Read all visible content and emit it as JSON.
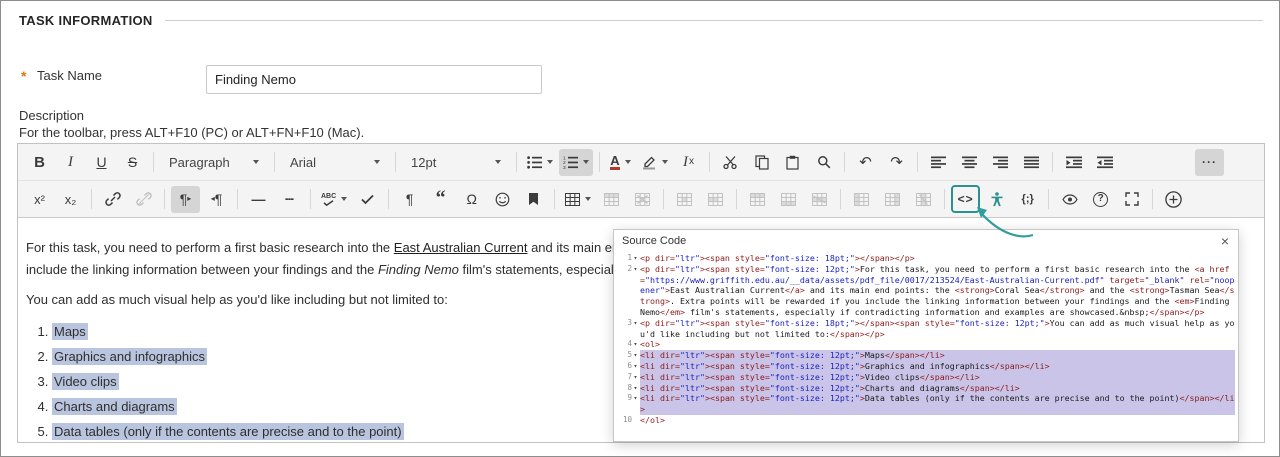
{
  "page": {
    "section_title": "TASK INFORMATION",
    "required_marker": "*",
    "task_name_label": "Task Name",
    "task_name_value": "Finding Nemo",
    "description_label": "Description",
    "toolbar_hint": "For the toolbar, press ALT+F10 (PC) or ALT+FN+F10 (Mac)."
  },
  "colors": {
    "accent_teal": "#2e8f8f",
    "selection_blue": "#b9c5de",
    "code_selection_purple": "#cac4e8",
    "required_orange": "#dd7a01"
  },
  "toolbar": {
    "row1": [
      {
        "icon": "bold-icon",
        "name": "bold-button"
      },
      {
        "icon": "italic-icon",
        "name": "italic-button"
      },
      {
        "icon": "underline-icon",
        "name": "underline-button"
      },
      {
        "icon": "strikethrough-icon",
        "name": "strikethrough-button"
      },
      {
        "sep": true
      },
      {
        "label": "Paragraph",
        "name": "paragraph-style-select",
        "dropdown": true,
        "width": 108
      },
      {
        "sep": true
      },
      {
        "label": "Arial",
        "name": "font-family-select",
        "dropdown": true,
        "width": 108
      },
      {
        "sep": true
      },
      {
        "label": "12pt",
        "name": "font-size-select",
        "dropdown": true,
        "width": 108
      },
      {
        "sep": true
      },
      {
        "icon": "bullet-list-icon",
        "name": "bullet-list-button",
        "dropdown": true
      },
      {
        "icon": "numbered-list-icon",
        "name": "numbered-list-button",
        "dropdown": true,
        "state": "active"
      },
      {
        "sep": true
      },
      {
        "icon": "text-color-icon",
        "name": "text-color-button",
        "dropdown": true
      },
      {
        "icon": "highlight-color-icon",
        "name": "highlight-color-button",
        "dropdown": true
      },
      {
        "icon": "clear-formatting-icon",
        "name": "clear-formatting-button"
      },
      {
        "sep": true
      },
      {
        "icon": "cut-icon",
        "name": "cut-button"
      },
      {
        "icon": "copy-icon",
        "name": "copy-button"
      },
      {
        "icon": "paste-icon",
        "name": "paste-button"
      },
      {
        "icon": "search-icon",
        "name": "find-replace-button"
      },
      {
        "sep": true
      },
      {
        "icon": "undo-icon",
        "name": "undo-button"
      },
      {
        "icon": "redo-icon",
        "name": "redo-button"
      },
      {
        "sep": true
      },
      {
        "icon": "align-left-icon",
        "name": "align-left-button"
      },
      {
        "icon": "align-center-icon",
        "name": "align-center-button"
      },
      {
        "icon": "align-right-icon",
        "name": "align-right-button"
      },
      {
        "icon": "align-justify-icon",
        "name": "align-justify-button"
      },
      {
        "sep": true
      },
      {
        "icon": "indent-icon",
        "name": "indent-button"
      },
      {
        "icon": "outdent-icon",
        "name": "outdent-button"
      },
      {
        "spacer": true
      },
      {
        "icon": "more-icon",
        "name": "show-more-toolbar-button",
        "state": "active",
        "more": true
      }
    ],
    "row2": [
      {
        "icon": "superscript-icon",
        "name": "superscript-button"
      },
      {
        "icon": "subscript-icon",
        "name": "subscript-button"
      },
      {
        "sep": true
      },
      {
        "icon": "link-icon",
        "name": "insert-link-button"
      },
      {
        "icon": "unlink-icon",
        "name": "remove-link-button",
        "state": "disabled"
      },
      {
        "sep": true
      },
      {
        "icon": "ltr-paragraph-icon",
        "name": "left-to-right-button",
        "state": "active"
      },
      {
        "icon": "rtl-paragraph-icon",
        "name": "right-to-left-button"
      },
      {
        "sep": true
      },
      {
        "icon": "horizontal-rule-icon",
        "name": "horizontal-line-button"
      },
      {
        "icon": "page-break-icon",
        "name": "page-break-button"
      },
      {
        "sep": true
      },
      {
        "icon": "spellcheck-icon",
        "name": "spellcheck-button",
        "dropdown": true
      },
      {
        "icon": "checkmark-icon",
        "name": "checkmark-button"
      },
      {
        "sep": true
      },
      {
        "icon": "pilcrow-icon",
        "name": "show-paragraph-marks-button"
      },
      {
        "icon": "blockquote-icon",
        "name": "blockquote-button"
      },
      {
        "icon": "omega-icon",
        "name": "special-character-button"
      },
      {
        "icon": "emoji-icon",
        "name": "emoticons-button"
      },
      {
        "icon": "anchor-bookmark-icon",
        "name": "anchor-button"
      },
      {
        "sep": true
      },
      {
        "icon": "table-icon",
        "name": "table-button",
        "dropdown": true
      },
      {
        "icon": "table-properties-icon",
        "name": "table-properties-button",
        "state": "disabled"
      },
      {
        "icon": "delete-table-icon",
        "name": "delete-table-button",
        "state": "disabled"
      },
      {
        "sep": true
      },
      {
        "icon": "cell-properties-icon",
        "name": "cell-properties-button",
        "state": "disabled"
      },
      {
        "icon": "merge-cells-icon",
        "name": "merge-cells-button",
        "state": "disabled"
      },
      {
        "sep": true
      },
      {
        "icon": "insert-row-above-icon",
        "name": "insert-row-above-button",
        "state": "disabled"
      },
      {
        "icon": "insert-row-below-icon",
        "name": "insert-row-below-button",
        "state": "disabled"
      },
      {
        "icon": "delete-row-icon",
        "name": "delete-row-button",
        "state": "disabled"
      },
      {
        "sep": true
      },
      {
        "icon": "insert-column-before-icon",
        "name": "insert-column-before-button",
        "state": "disabled"
      },
      {
        "icon": "insert-column-after-icon",
        "name": "insert-column-after-button",
        "state": "disabled"
      },
      {
        "icon": "delete-column-icon",
        "name": "delete-column-button",
        "state": "disabled"
      },
      {
        "sep": true
      },
      {
        "icon": "source-code-icon",
        "name": "source-code-button",
        "state": "outlined"
      },
      {
        "icon": "accessibility-icon",
        "name": "accessibility-checker-button",
        "state": "teal"
      },
      {
        "icon": "code-sample-icon",
        "name": "code-sample-button"
      },
      {
        "sep": true
      },
      {
        "icon": "preview-eye-icon",
        "name": "preview-button"
      },
      {
        "icon": "help-icon",
        "name": "help-button"
      },
      {
        "icon": "fullscreen-icon",
        "name": "fullscreen-button"
      },
      {
        "sep": true
      },
      {
        "icon": "add-plus-icon",
        "name": "add-content-button"
      }
    ]
  },
  "editor_content": {
    "paragraph1_line1": [
      {
        "t": "For this task, you need to perform a first basic research into the "
      },
      {
        "t": "East Australian Current",
        "style": "link"
      },
      {
        "t": " and its main end points: the "
      },
      {
        "t": "Coral Sea",
        "style": "bold"
      },
      {
        "t": " and the "
      },
      {
        "t": "Tasman Sea",
        "style": "bold"
      },
      {
        "t": ". Extra points will be rewarded if you"
      }
    ],
    "paragraph1_line2": [
      {
        "t": "include the linking information between your findings and the "
      },
      {
        "t": "Finding Nemo",
        "style": "italic"
      },
      {
        "t": " film's statements, especially if contradicting information and examples are showcased."
      }
    ],
    "paragraph2": "You can add as much visual help as you'd like including but not limited to:",
    "list_items": [
      "Maps",
      "Graphics and infographics",
      "Video clips",
      "Charts and diagrams",
      "Data tables (only if the contents are precise and to the point)"
    ]
  },
  "source_code_panel": {
    "title": "Source Code",
    "close_label": "×",
    "lines": [
      {
        "n": 1,
        "fold": true,
        "selected": false,
        "code": "<p dir=\"ltr\"><span style=\"font-size: 18pt;\"></span></p>"
      },
      {
        "n": 2,
        "fold": true,
        "selected": false,
        "code": "<p dir=\"ltr\"><span style=\"font-size: 12pt;\">For this task, you need to perform a first basic research into the <a href=\"https://www.griffith.edu.au/__data/assets/pdf_file/0017/213524/East-Australian-Current.pdf\" target=\"_blank\" rel=\"noopener\">East Australian Current</a> and its main end points: the <strong>Coral Sea</strong> and the <strong>Tasman Sea</strong>. Extra points will be rewarded if you include the linking information between your findings and the <em>Finding Nemo</em> film's statements, especially if contradicting information and examples are showcased.&nbsp;</span></p>"
      },
      {
        "n": 3,
        "fold": true,
        "selected": false,
        "code": "<p dir=\"ltr\"><span style=\"font-size: 18pt;\"></span><span style=\"font-size: 12pt;\">You can add as much visual help as you'd like including but not limited to:</span></p>"
      },
      {
        "n": 4,
        "fold": true,
        "selected": false,
        "code": "<ol>"
      },
      {
        "n": 5,
        "fold": true,
        "selected": true,
        "code": "<li dir=\"ltr\"><span style=\"font-size: 12pt;\">Maps</span></li>"
      },
      {
        "n": 6,
        "fold": true,
        "selected": true,
        "code": "<li dir=\"ltr\"><span style=\"font-size: 12pt;\">Graphics and infographics</span></li>"
      },
      {
        "n": 7,
        "fold": true,
        "selected": true,
        "code": "<li dir=\"ltr\"><span style=\"font-size: 12pt;\">Video clips</span></li>"
      },
      {
        "n": 8,
        "fold": true,
        "selected": true,
        "code": "<li dir=\"ltr\"><span style=\"font-size: 12pt;\">Charts and diagrams</span></li>"
      },
      {
        "n": 9,
        "fold": true,
        "selected": true,
        "code": "<li dir=\"ltr\"><span style=\"font-size: 12pt;\">Data tables (only if the contents are precise and to the point)</span></li>"
      },
      {
        "n": 10,
        "fold": false,
        "selected": false,
        "code": "</ol>"
      }
    ]
  }
}
